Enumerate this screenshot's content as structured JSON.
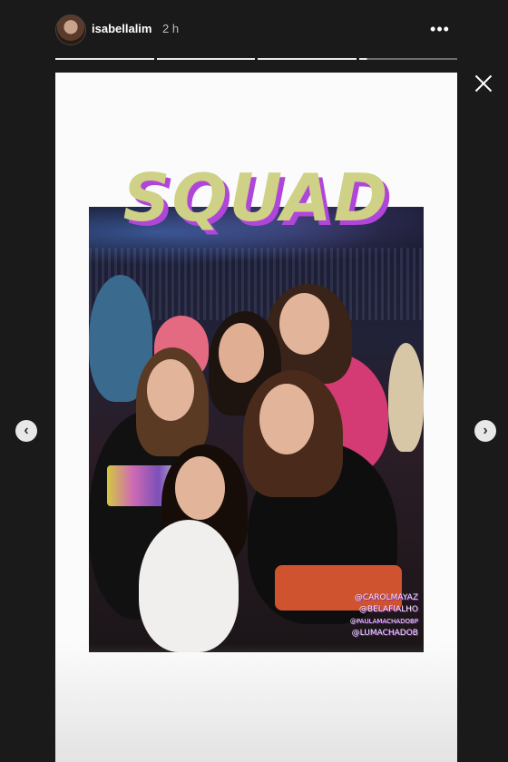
{
  "header": {
    "username": "isabellalim",
    "time": "2 h",
    "more_icon": "•••",
    "progress_segments": 4,
    "current_segment": 4,
    "current_segment_progress": 0.08
  },
  "story": {
    "sticker_text": "SQUAD",
    "tags": [
      "@CAROLMAYAZ",
      "@BELAFIALHO",
      "@PAULAMACHADOBP",
      "@LUMACHADOB"
    ],
    "colors": {
      "sticker_fill": "#cfd186",
      "sticker_shadow": "#b045d9"
    }
  },
  "nav": {
    "prev_icon": "‹",
    "next_icon": "›"
  }
}
